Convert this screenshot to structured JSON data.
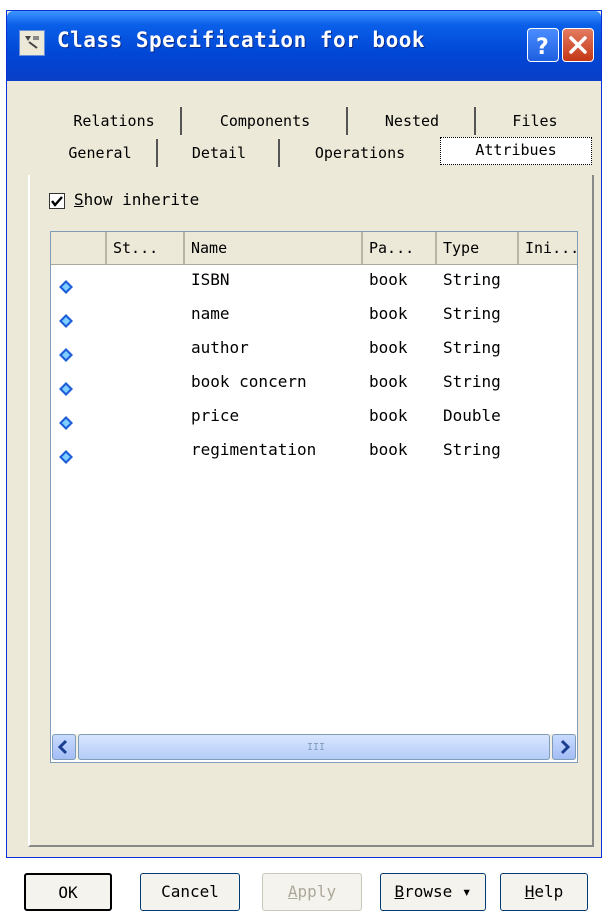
{
  "window": {
    "title": "Class Specification for book",
    "help_button": "?",
    "close_button": "×"
  },
  "tabs": {
    "row1": [
      "Relations",
      "Components",
      "Nested",
      "Files"
    ],
    "row2": [
      "General",
      "Detail",
      "Operations",
      "Attribues"
    ],
    "active": "Attribues"
  },
  "options": {
    "show_inherited_prefix": "S",
    "show_inherited_rest": "how inherite",
    "checked": true
  },
  "list": {
    "columns": [
      "St...",
      "Name",
      "Pa...",
      "Type",
      "Ini..."
    ],
    "rows": [
      {
        "name": "ISBN",
        "parent": "book",
        "type": "String"
      },
      {
        "name": "name",
        "parent": "book",
        "type": "String"
      },
      {
        "name": "author",
        "parent": "book",
        "type": "String"
      },
      {
        "name": "book concern",
        "parent": "book",
        "type": "String"
      },
      {
        "name": "price",
        "parent": "book",
        "type": "Double"
      },
      {
        "name": "regimentation",
        "parent": "book",
        "type": "String"
      }
    ],
    "icon": "attribute-diamond-icon",
    "icon_color": "#1e5fd8"
  },
  "scrollbar": {
    "left_arrow": "<",
    "right_arrow": ">",
    "grip": "III"
  },
  "buttons": {
    "ok": "OK",
    "cancel": "Cancel",
    "apply_accel": "A",
    "apply_rest": "pply",
    "browse_accel": "B",
    "browse_rest": "rowse ▾",
    "help_accel": "H",
    "help_rest": "elp"
  },
  "colors": {
    "titlebar": "#0a5fe8",
    "dialog_bg": "#ece9d8",
    "close_button": "#c33716"
  }
}
